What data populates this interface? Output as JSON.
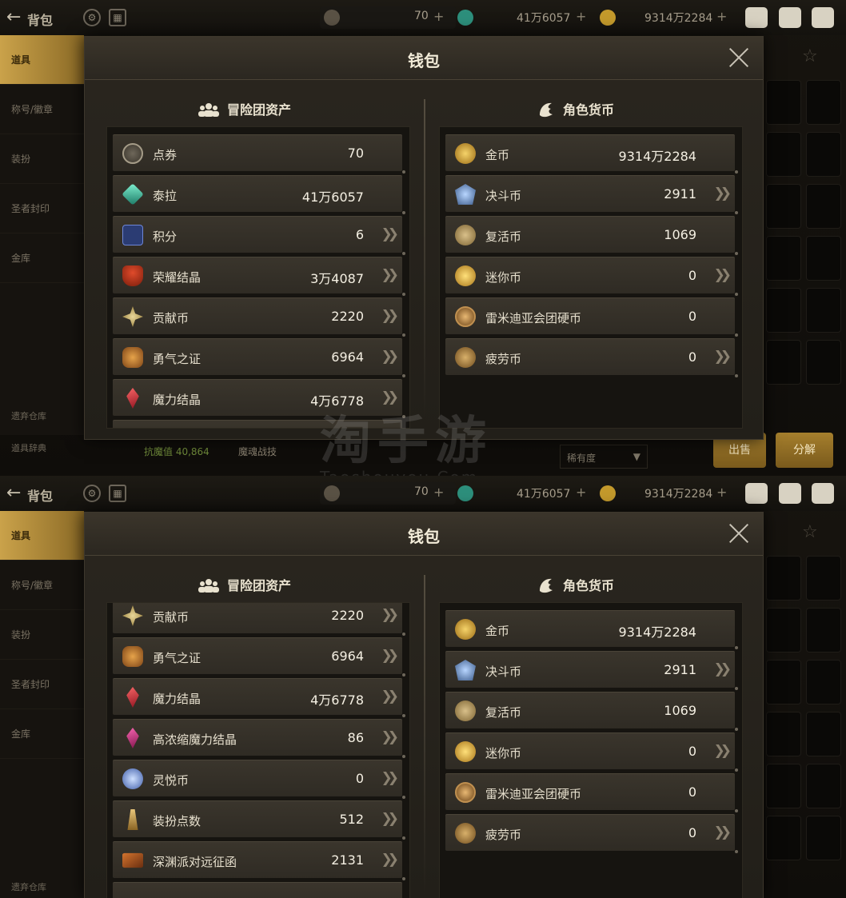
{
  "header": {
    "back_label": "背包",
    "currency_coupon": "70",
    "currency_tera": "41万6057",
    "currency_gold": "9314万2284"
  },
  "left_menu": [
    "道具",
    "称号/徽章",
    "装扮",
    "圣者封印",
    "金库"
  ],
  "left_menu_bottom": [
    "遗弃仓库",
    "道具辞典"
  ],
  "status": {
    "text1": "抗魔值 40,864",
    "text2": "魔魂战技",
    "dropdown": "稀有度",
    "btn_sell": "出售",
    "btn_split": "分解"
  },
  "wallet": {
    "title": "钱包",
    "adventure_header": "冒险团资产",
    "character_header": "角色货币"
  },
  "screen1": {
    "adventure": [
      {
        "name": "点券",
        "value": "70",
        "arrow": false,
        "icon": "coupon-icon"
      },
      {
        "name": "泰拉",
        "value": "41万6057",
        "arrow": false,
        "icon": "tera-crystal-icon"
      },
      {
        "name": "积分",
        "value": "6",
        "arrow": true,
        "icon": "points-icon"
      },
      {
        "name": "荣耀结晶",
        "value": "3万4087",
        "arrow": true,
        "icon": "trophy-icon"
      },
      {
        "name": "贡献币",
        "value": "2220",
        "arrow": true,
        "icon": "contribution-coin-icon"
      },
      {
        "name": "勇气之证",
        "value": "6964",
        "arrow": true,
        "icon": "courage-badge-icon"
      },
      {
        "name": "魔力结晶",
        "value": "4万6778",
        "arrow": true,
        "icon": "mana-crystal-icon"
      }
    ],
    "character": [
      {
        "name": "金币",
        "value": "9314万2284",
        "arrow": false,
        "icon": "gold-coin-icon"
      },
      {
        "name": "决斗币",
        "value": "2911",
        "arrow": true,
        "icon": "duel-coin-icon"
      },
      {
        "name": "复活币",
        "value": "1069",
        "arrow": false,
        "icon": "revive-coin-icon"
      },
      {
        "name": "迷你币",
        "value": "0",
        "arrow": true,
        "icon": "mini-coin-icon"
      },
      {
        "name": "雷米迪亚会团硬币",
        "value": "0",
        "arrow": false,
        "icon": "remedia-coin-icon"
      },
      {
        "name": "疲劳币",
        "value": "0",
        "arrow": true,
        "icon": "fatigue-coin-icon"
      }
    ]
  },
  "screen2": {
    "adventure": [
      {
        "name": "贡献币",
        "value": "2220",
        "arrow": true,
        "icon": "contribution-coin-icon"
      },
      {
        "name": "勇气之证",
        "value": "6964",
        "arrow": true,
        "icon": "courage-badge-icon"
      },
      {
        "name": "魔力结晶",
        "value": "4万6778",
        "arrow": true,
        "icon": "mana-crystal-icon"
      },
      {
        "name": "高浓缩魔力结晶",
        "value": "86",
        "arrow": true,
        "icon": "concentrated-crystal-icon"
      },
      {
        "name": "灵悦币",
        "value": "0",
        "arrow": true,
        "icon": "spirit-coin-icon"
      },
      {
        "name": "装扮点数",
        "value": "512",
        "arrow": true,
        "icon": "costume-points-icon"
      },
      {
        "name": "深渊派对远征函",
        "value": "2131",
        "arrow": true,
        "icon": "abyss-ticket-icon"
      }
    ],
    "character": [
      {
        "name": "金币",
        "value": "9314万2284",
        "arrow": false,
        "icon": "gold-coin-icon"
      },
      {
        "name": "决斗币",
        "value": "2911",
        "arrow": true,
        "icon": "duel-coin-icon"
      },
      {
        "name": "复活币",
        "value": "1069",
        "arrow": false,
        "icon": "revive-coin-icon"
      },
      {
        "name": "迷你币",
        "value": "0",
        "arrow": true,
        "icon": "mini-coin-icon"
      },
      {
        "name": "雷米迪亚会团硬币",
        "value": "0",
        "arrow": false,
        "icon": "remedia-coin-icon"
      },
      {
        "name": "疲劳币",
        "value": "0",
        "arrow": true,
        "icon": "fatigue-coin-icon"
      }
    ]
  },
  "watermark": {
    "cn": "淘手游",
    "en": "Taoshouyou.Com"
  },
  "colors": {
    "accent_gold": "#caa24a",
    "panel_bg": "#161410",
    "row_bg": "#3a352c",
    "text": "#e6dfcd"
  }
}
